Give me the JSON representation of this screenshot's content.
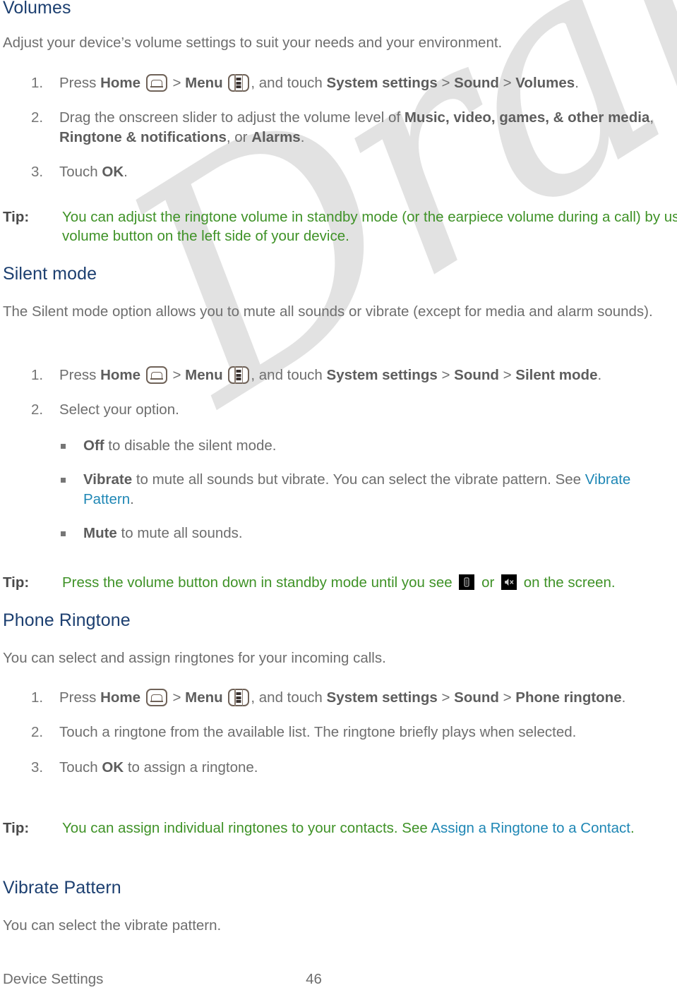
{
  "document": {
    "footer_section": "Device Settings",
    "page_number": "46",
    "watermark": "Draft"
  },
  "colors": {
    "heading": "#1c3f70",
    "body": "#6e6e6e",
    "tip": "#3f9227",
    "link": "#1f87b5",
    "watermark": "#e2e2e2"
  },
  "sections": [
    {
      "id": "volumes",
      "heading": "Volumes",
      "intro": "Adjust your device’s volume settings to suit your needs and your environment.",
      "steps": {
        "s1_a": "Press ",
        "s1_home": "Home",
        "s1_gt1": " > ",
        "s1_menu": "Menu",
        "s1_b": ", and touch ",
        "s1_system": "System settings",
        "s1_gt2": " > ",
        "s1_sound": "Sound",
        "s1_gt3": " > ",
        "s1_target": "Volumes",
        "s1_end": ".",
        "s2_a": "Drag the onscreen slider to adjust the volume level of ",
        "s2_b1": "Music, video, games, & other media",
        "s2_c": ", ",
        "s2_b2": "Ringtone & notifications",
        "s2_d": ", or ",
        "s2_b3": "Alarms",
        "s2_end": ".",
        "s3_a": "Touch ",
        "s3_b": "OK",
        "s3_end": "."
      },
      "tip": {
        "label": "Tip:",
        "text": "You can adjust the ringtone volume in standby mode (or the earpiece volume during a call) by using the volume button on the left side of your device."
      }
    },
    {
      "id": "silent-mode",
      "heading": "Silent mode",
      "intro": "The Silent mode option allows you to mute all sounds or vibrate (except for media and alarm sounds).",
      "steps": {
        "s1_a": "Press ",
        "s1_home": "Home",
        "s1_gt1": " > ",
        "s1_menu": "Menu",
        "s1_b": ", and touch ",
        "s1_system": "System settings",
        "s1_gt2": " > ",
        "s1_sound": "Sound",
        "s1_gt3": " > ",
        "s1_target": "Silent mode",
        "s1_end": ".",
        "s2": "Select your option."
      },
      "options": [
        {
          "term": "Off",
          "rest": " to disable the silent mode."
        },
        {
          "term": "Vibrate",
          "rest": " to mute all sounds but vibrate. You can select the vibrate pattern. See ",
          "link": "Vibrate Pattern",
          "after": "."
        },
        {
          "term": "Mute",
          "rest": " to mute all sounds."
        }
      ],
      "tip": {
        "label": "Tip:",
        "text_before": "Press the volume button down in standby mode until you see ",
        "icon1": "vibrate-icon",
        "text_middle": " or ",
        "icon2": "mute-icon",
        "text_after": " on the screen."
      }
    },
    {
      "id": "phone-ringtone",
      "heading": "Phone Ringtone",
      "intro": "You can select and assign ringtones for your incoming calls.",
      "steps": {
        "s1_a": "Press ",
        "s1_home": "Home",
        "s1_gt1": " > ",
        "s1_menu": "Menu",
        "s1_b": ", and touch ",
        "s1_system": "System settings",
        "s1_gt2": " > ",
        "s1_sound": "Sound",
        "s1_gt3": " > ",
        "s1_target": "Phone ringtone",
        "s1_end": ".",
        "s2": "Touch a ringtone from the available list. The ringtone briefly plays when selected.",
        "s3_a": "Touch ",
        "s3_b": "OK",
        "s3_end": " to assign a ringtone."
      },
      "tip": {
        "label": "Tip:",
        "text_before": "You can assign individual ringtones to your contacts. See ",
        "link": "Assign a Ringtone to a Contact",
        "after": "."
      }
    },
    {
      "id": "vibrate-pattern",
      "heading": "Vibrate Pattern",
      "intro": "You can select the vibrate pattern."
    }
  ]
}
